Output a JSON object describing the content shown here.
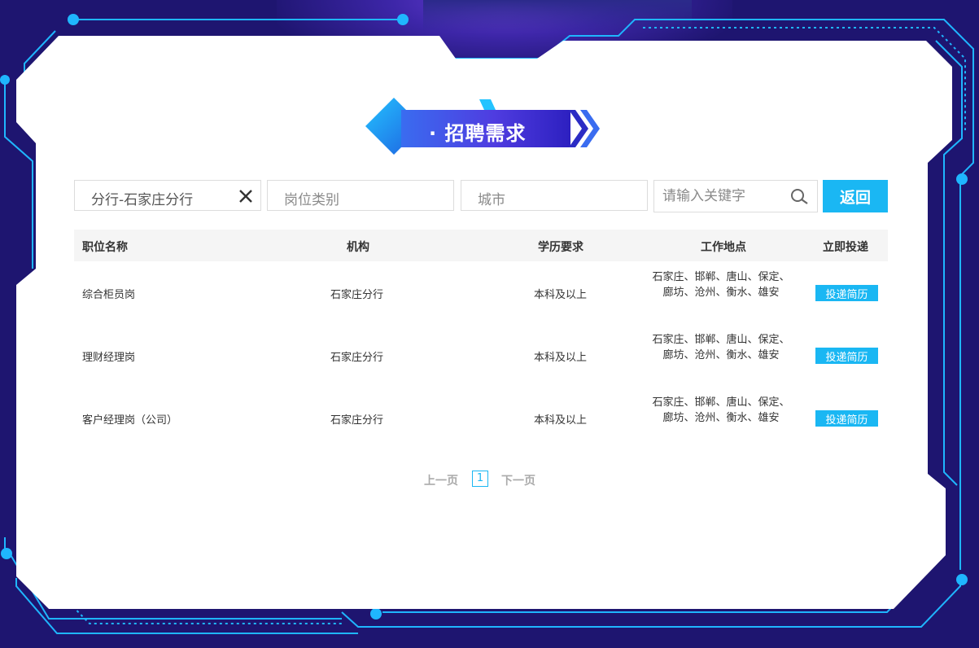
{
  "colors": {
    "accent": "#1ab7f3",
    "background": "#1e1570",
    "frame": "#1fb6ff",
    "heading_bar": "#4f3ce0"
  },
  "section": {
    "title": "· 招聘需求"
  },
  "filters": {
    "branch": {
      "value": "分行-石家庄分行",
      "clear_icon": "close-icon"
    },
    "category": {
      "placeholder": "岗位类别"
    },
    "city": {
      "placeholder": "城市"
    },
    "keyword": {
      "placeholder": "请输入关键字",
      "icon": "search-icon"
    },
    "back_label": "返回"
  },
  "table": {
    "headers": [
      "职位名称",
      "机构",
      "学历要求",
      "工作地点",
      "立即投递"
    ],
    "rows": [
      {
        "position": "综合柜员岗",
        "org": "石家庄分行",
        "education": "本科及以上",
        "location": "石家庄、邯郸、唐山、保定、廊坊、沧州、衡水、雄安",
        "apply": "投递简历"
      },
      {
        "position": "理财经理岗",
        "org": "石家庄分行",
        "education": "本科及以上",
        "location": "石家庄、邯郸、唐山、保定、廊坊、沧州、衡水、雄安",
        "apply": "投递简历"
      },
      {
        "position": "客户经理岗（公司）",
        "org": "石家庄分行",
        "education": "本科及以上",
        "location": "石家庄、邯郸、唐山、保定、廊坊、沧州、衡水、雄安",
        "apply": "投递简历"
      }
    ]
  },
  "pager": {
    "prev": "上一页",
    "current": "1",
    "next": "下一页"
  }
}
